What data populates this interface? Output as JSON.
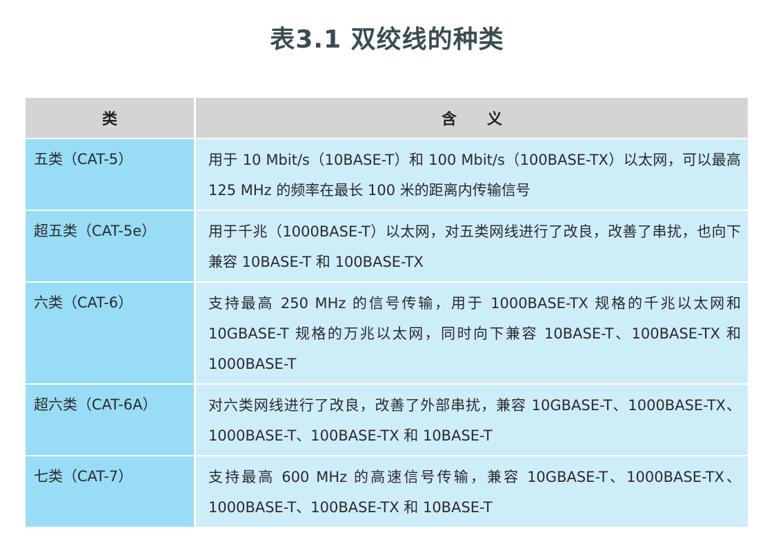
{
  "title": "表3.1 双绞线的种类",
  "headers": {
    "type": "类",
    "meaning": "含　　义"
  },
  "rows": [
    {
      "type": "五类（CAT-5）",
      "meaning": "用于 10 Mbit/s（10BASE-T）和 100 Mbit/s（100BASE-TX）以太网，可以最高 125 MHz 的频率在最长 100 米的距离内传输信号"
    },
    {
      "type": "超五类（CAT-5e）",
      "meaning": "用于千兆（1000BASE-T）以太网，对五类网线进行了改良，改善了串扰，也向下兼容 10BASE-T 和 100BASE-TX"
    },
    {
      "type": "六类（CAT-6）",
      "meaning": "支持最高 250 MHz 的信号传输，用于 1000BASE-TX 规格的千兆以太网和 10GBASE-T 规格的万兆以太网，同时向下兼容 10BASE-T、100BASE-TX 和 1000BASE-T"
    },
    {
      "type": "超六类（CAT-6A）",
      "meaning": "对六类网线进行了改良，改善了外部串扰，兼容 10GBASE-T、1000BASE-TX、1000BASE-T、100BASE-TX 和 10BASE-T"
    },
    {
      "type": "七类（CAT-7）",
      "meaning": "支持最高 600 MHz 的高速信号传输，兼容 10GBASE-T、1000BASE-TX、1000BASE-T、100BASE-TX 和 10BASE-T"
    }
  ]
}
